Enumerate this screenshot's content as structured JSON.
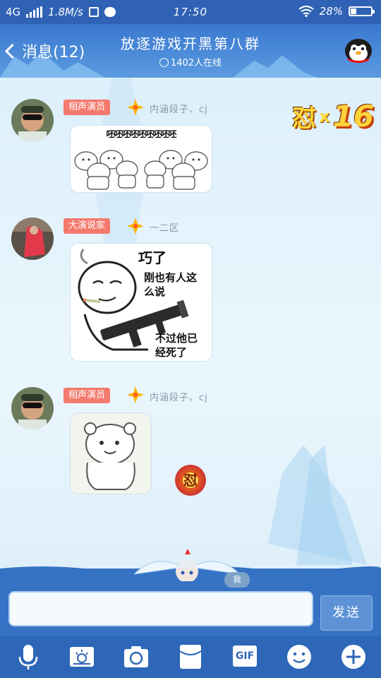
{
  "status_bar": {
    "network": "4G",
    "speed": "1.8M/s",
    "time": "17:50",
    "battery": "28%",
    "battery_level": 0.28
  },
  "header": {
    "back_label": "消息(12)",
    "title": "放逐游戏开黑第八群",
    "online_count": "1402人在线"
  },
  "messages": [
    {
      "badge": "相声演员",
      "username": "内涵段子、cj",
      "sticker_caption": "呸呸呸呸呸呸呸呸呸"
    },
    {
      "badge": "大演说家",
      "username": "一二区",
      "sticker_lines": [
        "巧了",
        "刚也有人这",
        "么说",
        "不过他已",
        "经死了"
      ]
    },
    {
      "badge": "相声演员",
      "username": "内涵段子、cj"
    }
  ],
  "combo": {
    "glyph": "怼",
    "times": "x",
    "count": "16"
  },
  "reaction_glyph": "怼",
  "mascot_tag": "我",
  "input": {
    "value": "",
    "send_label": "发送"
  },
  "toolbar": {
    "gif_label": "GIF"
  },
  "colors": {
    "header_blue": "#3a78cf",
    "status_blue": "#2f62b4",
    "badge_red": "#f57a6e",
    "toolbar_blue": "#2e66b8"
  },
  "icons": [
    "microphone-icon",
    "image-icon",
    "camera-icon",
    "red-packet-icon",
    "gif-icon",
    "emoji-icon",
    "plus-icon"
  ]
}
